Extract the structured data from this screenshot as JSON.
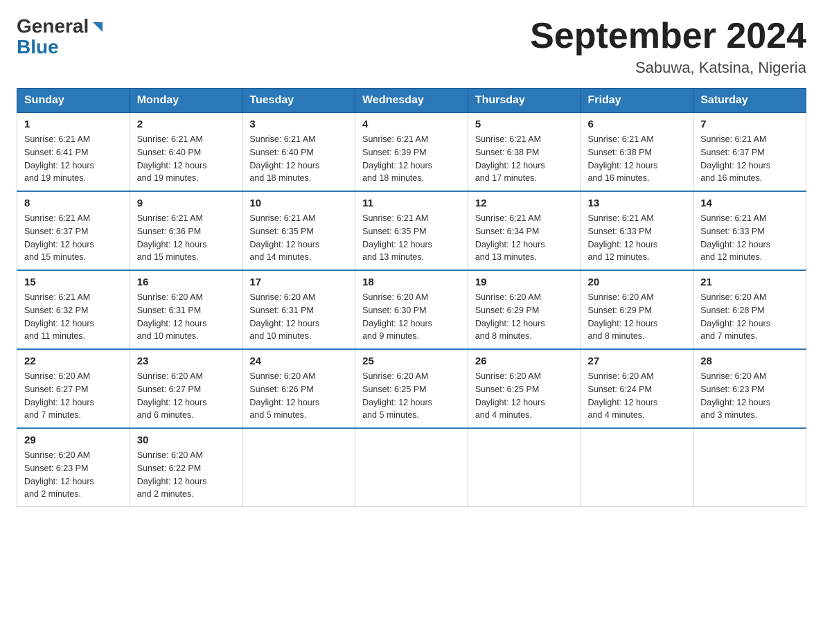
{
  "header": {
    "logo_general": "General",
    "logo_blue": "Blue",
    "month_title": "September 2024",
    "location": "Sabuwa, Katsina, Nigeria"
  },
  "days_of_week": [
    "Sunday",
    "Monday",
    "Tuesday",
    "Wednesday",
    "Thursday",
    "Friday",
    "Saturday"
  ],
  "weeks": [
    [
      {
        "day": "1",
        "sunrise": "6:21 AM",
        "sunset": "6:41 PM",
        "daylight": "12 hours and 19 minutes."
      },
      {
        "day": "2",
        "sunrise": "6:21 AM",
        "sunset": "6:40 PM",
        "daylight": "12 hours and 19 minutes."
      },
      {
        "day": "3",
        "sunrise": "6:21 AM",
        "sunset": "6:40 PM",
        "daylight": "12 hours and 18 minutes."
      },
      {
        "day": "4",
        "sunrise": "6:21 AM",
        "sunset": "6:39 PM",
        "daylight": "12 hours and 18 minutes."
      },
      {
        "day": "5",
        "sunrise": "6:21 AM",
        "sunset": "6:38 PM",
        "daylight": "12 hours and 17 minutes."
      },
      {
        "day": "6",
        "sunrise": "6:21 AM",
        "sunset": "6:38 PM",
        "daylight": "12 hours and 16 minutes."
      },
      {
        "day": "7",
        "sunrise": "6:21 AM",
        "sunset": "6:37 PM",
        "daylight": "12 hours and 16 minutes."
      }
    ],
    [
      {
        "day": "8",
        "sunrise": "6:21 AM",
        "sunset": "6:37 PM",
        "daylight": "12 hours and 15 minutes."
      },
      {
        "day": "9",
        "sunrise": "6:21 AM",
        "sunset": "6:36 PM",
        "daylight": "12 hours and 15 minutes."
      },
      {
        "day": "10",
        "sunrise": "6:21 AM",
        "sunset": "6:35 PM",
        "daylight": "12 hours and 14 minutes."
      },
      {
        "day": "11",
        "sunrise": "6:21 AM",
        "sunset": "6:35 PM",
        "daylight": "12 hours and 13 minutes."
      },
      {
        "day": "12",
        "sunrise": "6:21 AM",
        "sunset": "6:34 PM",
        "daylight": "12 hours and 13 minutes."
      },
      {
        "day": "13",
        "sunrise": "6:21 AM",
        "sunset": "6:33 PM",
        "daylight": "12 hours and 12 minutes."
      },
      {
        "day": "14",
        "sunrise": "6:21 AM",
        "sunset": "6:33 PM",
        "daylight": "12 hours and 12 minutes."
      }
    ],
    [
      {
        "day": "15",
        "sunrise": "6:21 AM",
        "sunset": "6:32 PM",
        "daylight": "12 hours and 11 minutes."
      },
      {
        "day": "16",
        "sunrise": "6:20 AM",
        "sunset": "6:31 PM",
        "daylight": "12 hours and 10 minutes."
      },
      {
        "day": "17",
        "sunrise": "6:20 AM",
        "sunset": "6:31 PM",
        "daylight": "12 hours and 10 minutes."
      },
      {
        "day": "18",
        "sunrise": "6:20 AM",
        "sunset": "6:30 PM",
        "daylight": "12 hours and 9 minutes."
      },
      {
        "day": "19",
        "sunrise": "6:20 AM",
        "sunset": "6:29 PM",
        "daylight": "12 hours and 8 minutes."
      },
      {
        "day": "20",
        "sunrise": "6:20 AM",
        "sunset": "6:29 PM",
        "daylight": "12 hours and 8 minutes."
      },
      {
        "day": "21",
        "sunrise": "6:20 AM",
        "sunset": "6:28 PM",
        "daylight": "12 hours and 7 minutes."
      }
    ],
    [
      {
        "day": "22",
        "sunrise": "6:20 AM",
        "sunset": "6:27 PM",
        "daylight": "12 hours and 7 minutes."
      },
      {
        "day": "23",
        "sunrise": "6:20 AM",
        "sunset": "6:27 PM",
        "daylight": "12 hours and 6 minutes."
      },
      {
        "day": "24",
        "sunrise": "6:20 AM",
        "sunset": "6:26 PM",
        "daylight": "12 hours and 5 minutes."
      },
      {
        "day": "25",
        "sunrise": "6:20 AM",
        "sunset": "6:25 PM",
        "daylight": "12 hours and 5 minutes."
      },
      {
        "day": "26",
        "sunrise": "6:20 AM",
        "sunset": "6:25 PM",
        "daylight": "12 hours and 4 minutes."
      },
      {
        "day": "27",
        "sunrise": "6:20 AM",
        "sunset": "6:24 PM",
        "daylight": "12 hours and 4 minutes."
      },
      {
        "day": "28",
        "sunrise": "6:20 AM",
        "sunset": "6:23 PM",
        "daylight": "12 hours and 3 minutes."
      }
    ],
    [
      {
        "day": "29",
        "sunrise": "6:20 AM",
        "sunset": "6:23 PM",
        "daylight": "12 hours and 2 minutes."
      },
      {
        "day": "30",
        "sunrise": "6:20 AM",
        "sunset": "6:22 PM",
        "daylight": "12 hours and 2 minutes."
      },
      null,
      null,
      null,
      null,
      null
    ]
  ],
  "labels": {
    "sunrise_prefix": "Sunrise: ",
    "sunset_prefix": "Sunset: ",
    "daylight_prefix": "Daylight: "
  }
}
